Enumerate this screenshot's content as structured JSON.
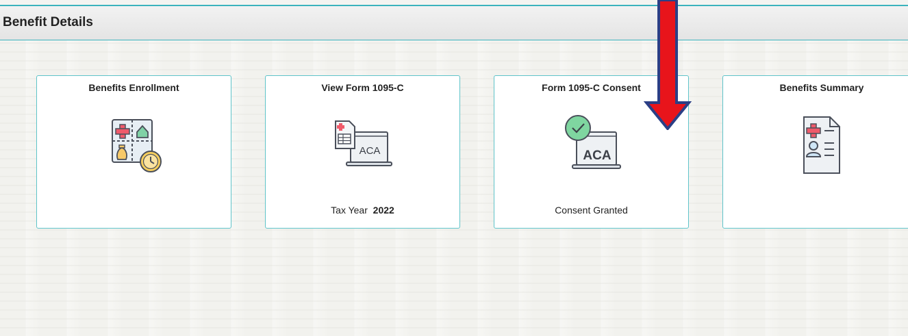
{
  "header": {
    "title": "Benefit Details"
  },
  "tiles": [
    {
      "title": "Benefits Enrollment",
      "icon": "benefits-enrollment-icon",
      "subtitle": ""
    },
    {
      "title": "View Form 1095-C",
      "icon": "form-1095c-aca-icon",
      "subtitle_label": "Tax Year",
      "subtitle_value": "2022",
      "icon_text": "ACA"
    },
    {
      "title": "Form 1095-C Consent",
      "icon": "consent-aca-icon",
      "subtitle": "Consent Granted",
      "icon_text": "ACA"
    },
    {
      "title": "Benefits Summary",
      "icon": "benefits-summary-icon",
      "subtitle": ""
    }
  ],
  "colors": {
    "accent": "#3bb3bd",
    "tile_border": "#5ec3c9",
    "arrow_fill": "#e8141b",
    "arrow_outline": "#2b3f86"
  }
}
